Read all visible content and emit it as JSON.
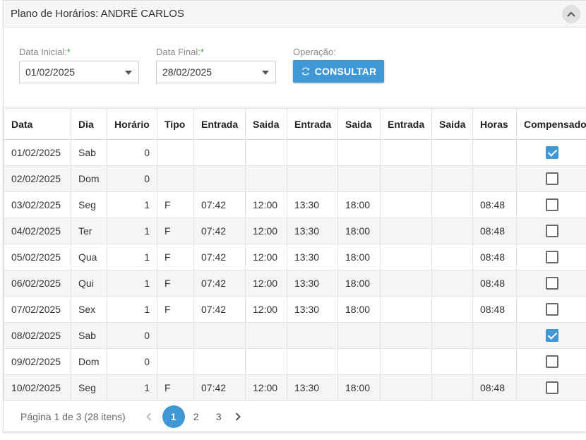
{
  "panel": {
    "title": "Plano de Horários: ANDRÉ CARLOS"
  },
  "form": {
    "start": {
      "label": "Data Inicial:",
      "required_mark": "*",
      "value": "01/02/2025"
    },
    "end": {
      "label": "Data Final:",
      "required_mark": "*",
      "value": "28/02/2025"
    },
    "operation": {
      "label": "Operação:",
      "button_label": "CONSULTAR"
    }
  },
  "table": {
    "columns": [
      "Data",
      "Dia",
      "Horário",
      "Tipo",
      "Entrada",
      "Saida",
      "Entrada",
      "Saida",
      "Entrada",
      "Saida",
      "Horas",
      "Compensado"
    ],
    "rows": [
      {
        "data": "01/02/2025",
        "dia": "Sab",
        "horario": "0",
        "tipo": "",
        "e1": "",
        "s1": "",
        "e2": "",
        "s2": "",
        "e3": "",
        "s3": "",
        "horas": "",
        "compensado": true
      },
      {
        "data": "02/02/2025",
        "dia": "Dom",
        "horario": "0",
        "tipo": "",
        "e1": "",
        "s1": "",
        "e2": "",
        "s2": "",
        "e3": "",
        "s3": "",
        "horas": "",
        "compensado": false
      },
      {
        "data": "03/02/2025",
        "dia": "Seg",
        "horario": "1",
        "tipo": "F",
        "e1": "07:42",
        "s1": "12:00",
        "e2": "13:30",
        "s2": "18:00",
        "e3": "",
        "s3": "",
        "horas": "08:48",
        "compensado": false
      },
      {
        "data": "04/02/2025",
        "dia": "Ter",
        "horario": "1",
        "tipo": "F",
        "e1": "07:42",
        "s1": "12:00",
        "e2": "13:30",
        "s2": "18:00",
        "e3": "",
        "s3": "",
        "horas": "08:48",
        "compensado": false
      },
      {
        "data": "05/02/2025",
        "dia": "Qua",
        "horario": "1",
        "tipo": "F",
        "e1": "07:42",
        "s1": "12:00",
        "e2": "13:30",
        "s2": "18:00",
        "e3": "",
        "s3": "",
        "horas": "08:48",
        "compensado": false
      },
      {
        "data": "06/02/2025",
        "dia": "Qui",
        "horario": "1",
        "tipo": "F",
        "e1": "07:42",
        "s1": "12:00",
        "e2": "13:30",
        "s2": "18:00",
        "e3": "",
        "s3": "",
        "horas": "08:48",
        "compensado": false
      },
      {
        "data": "07/02/2025",
        "dia": "Sex",
        "horario": "1",
        "tipo": "F",
        "e1": "07:42",
        "s1": "12:00",
        "e2": "13:30",
        "s2": "18:00",
        "e3": "",
        "s3": "",
        "horas": "08:48",
        "compensado": false
      },
      {
        "data": "08/02/2025",
        "dia": "Sab",
        "horario": "0",
        "tipo": "",
        "e1": "",
        "s1": "",
        "e2": "",
        "s2": "",
        "e3": "",
        "s3": "",
        "horas": "",
        "compensado": true
      },
      {
        "data": "09/02/2025",
        "dia": "Dom",
        "horario": "0",
        "tipo": "",
        "e1": "",
        "s1": "",
        "e2": "",
        "s2": "",
        "e3": "",
        "s3": "",
        "horas": "",
        "compensado": false
      },
      {
        "data": "10/02/2025",
        "dia": "Seg",
        "horario": "1",
        "tipo": "F",
        "e1": "07:42",
        "s1": "12:00",
        "e2": "13:30",
        "s2": "18:00",
        "e3": "",
        "s3": "",
        "horas": "08:48",
        "compensado": false
      }
    ]
  },
  "pager": {
    "info": "Página 1 de 3 (28 itens)",
    "pages": [
      "1",
      "2",
      "3"
    ],
    "current": "1"
  },
  "icons": {
    "collapse": "chevron-up-icon",
    "consultar": "refresh-icon",
    "prev": "chevron-left-icon",
    "next": "chevron-right-icon",
    "dropdown": "caret-down-icon"
  },
  "colors": {
    "accent": "#3f97d4",
    "required": "#3a9b3a"
  }
}
